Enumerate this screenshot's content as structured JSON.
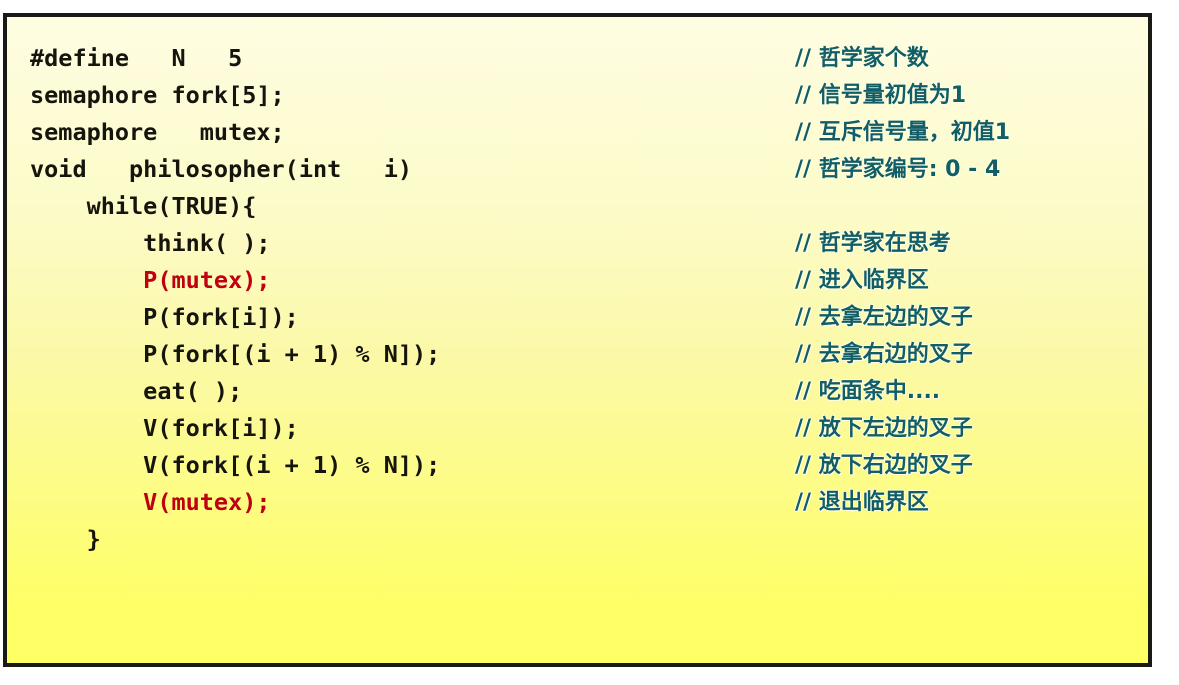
{
  "slide": {
    "kind": "code-listing",
    "topic": "dining-philosophers-semaphore-solution",
    "panel": {
      "border_color": "#1a1a14",
      "background_top_color": "#fefde2",
      "background_bottom_color": "#ffff66"
    },
    "colors": {
      "code": "#15140d",
      "code_accent": "#bf0011",
      "comment": "#125e68"
    }
  },
  "code_lines": [
    {
      "code": "#define   N   5",
      "comment": "// 哲学家个数",
      "accent": false
    },
    {
      "code": "semaphore fork[5];",
      "comment": "// 信号量初值为1",
      "accent": false
    },
    {
      "code": "semaphore   mutex;",
      "comment": "// 互斥信号量，初值1",
      "accent": false
    },
    {
      "code": "void   philosopher(int   i)",
      "comment": "// 哲学家编号: 0 - 4",
      "accent": false
    },
    {
      "code": "    while(TRUE){",
      "comment": "",
      "accent": false
    },
    {
      "code": "        think( );",
      "comment": "// 哲学家在思考",
      "accent": false
    },
    {
      "code": "        P(mutex);",
      "comment": "// 进入临界区",
      "accent": true
    },
    {
      "code": "        P(fork[i]);",
      "comment": "// 去拿左边的叉子",
      "accent": false
    },
    {
      "code": "        P(fork[(i + 1) % N]);",
      "comment": "// 去拿右边的叉子",
      "accent": false
    },
    {
      "code": "        eat( );",
      "comment": "// 吃面条中....",
      "accent": false
    },
    {
      "code": "        V(fork[i]);",
      "comment": "// 放下左边的叉子",
      "accent": false
    },
    {
      "code": "        V(fork[(i + 1) % N]);",
      "comment": "// 放下右边的叉子",
      "accent": false
    },
    {
      "code": "        V(mutex);",
      "comment": "// 退出临界区",
      "accent": true
    },
    {
      "code": "    }",
      "comment": "",
      "accent": false
    }
  ]
}
